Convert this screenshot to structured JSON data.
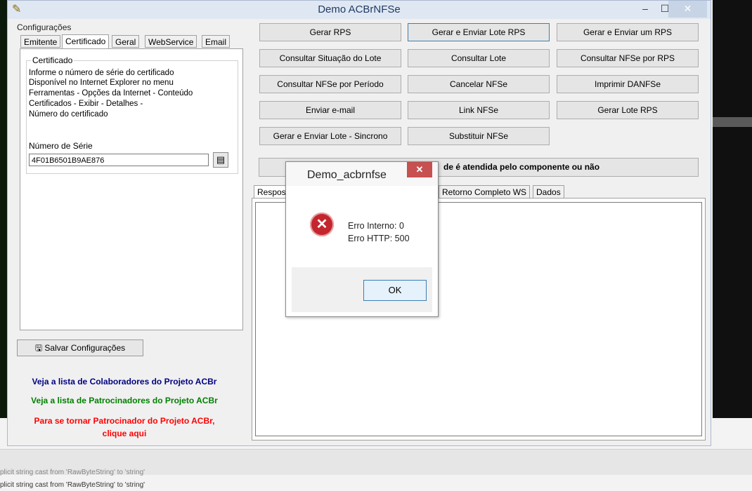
{
  "window": {
    "title": "Demo ACBrNFSe",
    "minimize": "–",
    "maximize": "☐",
    "close": "✕",
    "icon_name": "acbr-app-icon"
  },
  "config": {
    "group_label": "Configurações",
    "tabs": [
      "Emitente",
      "Certificado",
      "Geral",
      "WebService",
      "Email"
    ],
    "active_tab": "Certificado",
    "cert_group_title": "Certificado",
    "info_lines": [
      "Informe o número de série do certificado",
      "Disponível no Internet Explorer no menu",
      "Ferramentas - Opções da Internet - Conteúdo",
      "Certificados - Exibir - Detalhes -",
      "Número do certificado"
    ],
    "serial_label": "Número de Série",
    "serial_value": "4F01B6501B9AE876",
    "save_label": "Salvar Configurações"
  },
  "links": {
    "collaborators": "Veja a lista de Colaboradores do Projeto ACBr",
    "sponsors": "Veja a lista de Patrocinadores do Projeto ACBr",
    "become_1": "Para se tornar Patrocinador do Projeto ACBr,",
    "become_2": "clique aqui"
  },
  "actions": {
    "gerar_rps": "Gerar RPS",
    "gerar_enviar_lote": "Gerar e Enviar Lote RPS",
    "gerar_enviar_um": "Gerar e Enviar um RPS",
    "consultar_situacao": "Consultar Situação do Lote",
    "consultar_lote": "Consultar Lote",
    "consultar_nfse_rps": "Consultar NFSe por RPS",
    "consultar_periodo": "Consultar NFSe por Período",
    "cancelar": "Cancelar NFSe",
    "imprimir": "Imprimir DANFSe",
    "enviar_email": "Enviar e-mail",
    "link": "Link NFSe",
    "gerar_lote": "Gerar Lote RPS",
    "sincrono": "Gerar e Enviar Lote - Sincrono",
    "substituir": "Substituir NFSe",
    "info_partial": "de é atendida pelo componente ou não"
  },
  "response_tabs": {
    "first_partial": "Respos",
    "retorno": "Retorno Completo WS",
    "dados": "Dados"
  },
  "dialog": {
    "title": "Demo_acbrnfse",
    "close": "✕",
    "icon": "✕",
    "line1": "Erro Interno: 0",
    "line2": "Erro HTTP: 500",
    "ok": "OK"
  },
  "log": {
    "line1": "plicit string cast from 'RawByteString' to 'string'",
    "line2": "plicit string cast from 'RawByteString' to 'string'"
  }
}
